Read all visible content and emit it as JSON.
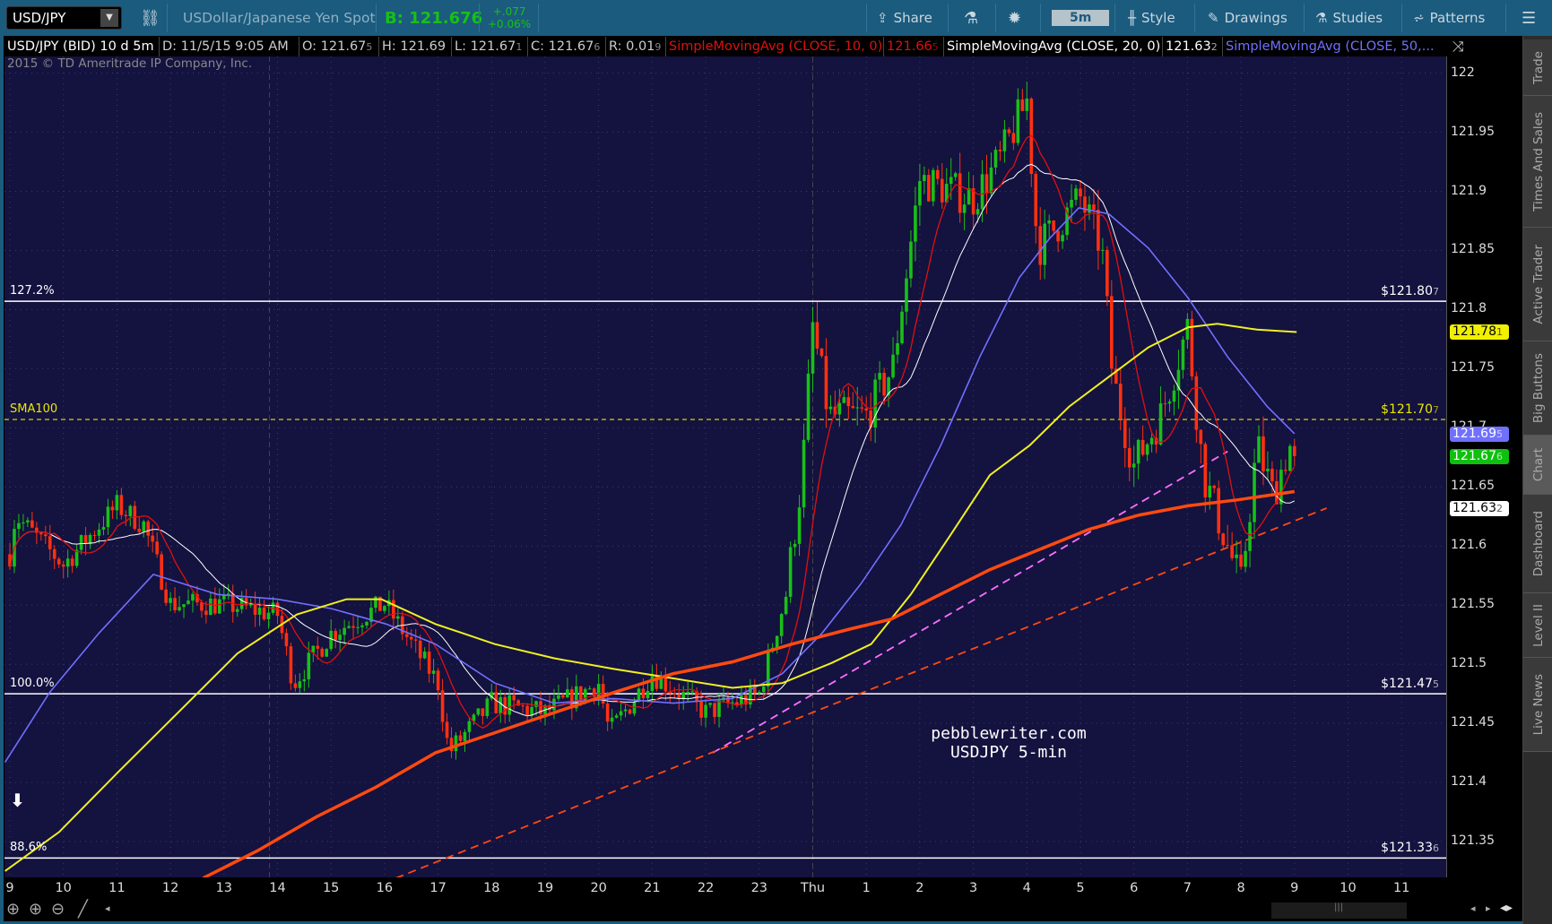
{
  "toolbar": {
    "symbol": "USD/JPY",
    "description": "USDollar/Japanese Yen Spot",
    "bid": "B: 121.676",
    "change_abs": "+.077",
    "change_pct": "+0.06%",
    "share": "Share",
    "timeframe": "5m",
    "style": "Style",
    "drawings": "Drawings",
    "studies": "Studies",
    "patterns": "Patterns"
  },
  "infobar": {
    "title": "USD/JPY (BID) 10 d 5m",
    "date": "D: 11/5/15 9:05 AM",
    "open": [
      "O: 121.67",
      "5"
    ],
    "high": [
      "H: 121.69",
      ""
    ],
    "low": [
      "L: 121.67",
      "1"
    ],
    "close": [
      "C: 121.67",
      "6"
    ],
    "range": [
      "R: 0.01",
      "9"
    ],
    "sma10": "SimpleMovingAvg (CLOSE, 10, 0)",
    "sma10_val": [
      "121.66",
      "5"
    ],
    "sma20": "SimpleMovingAvg (CLOSE, 20, 0)",
    "sma20_val": [
      "121.63",
      "2"
    ],
    "sma50": "SimpleMovingAvg (CLOSE, 50,..."
  },
  "copyright": "2015 © TD Ameritrade IP Company, Inc.",
  "levels": [
    {
      "label": "127.2%",
      "price": 121.807,
      "text": [
        "$121.80",
        "7"
      ],
      "color": "#ffffff",
      "dashed": false
    },
    {
      "label": "SMA100",
      "price": 121.707,
      "text": [
        "$121.70",
        "7"
      ],
      "color": "#e8e800",
      "dashed": true
    },
    {
      "label": "100.0%",
      "price": 121.475,
      "text": [
        "$121.47",
        "5"
      ],
      "color": "#ffffff",
      "dashed": false
    },
    {
      "label": "88.6%",
      "price": 121.336,
      "text": [
        "$121.33",
        "6"
      ],
      "color": "#ffffff",
      "dashed": false
    }
  ],
  "watermark": {
    "line1": "pebblewriter.com",
    "line2": "USDJPY 5-min"
  },
  "sidebar": [
    "Trade",
    "Times And Sales",
    "Active Trader",
    "Big Buttons",
    "Chart",
    "Dashboard",
    "Level II",
    "Live News"
  ],
  "chart_data": {
    "type": "candlestick",
    "ylim": [
      121.32,
      122.01
    ],
    "yticks": [
      "122",
      "121.95",
      "121.9",
      "121.85",
      "121.8",
      "121.75",
      "121.7",
      "121.65",
      "121.6",
      "121.55",
      "121.5",
      "121.45",
      "121.4",
      "121.35"
    ],
    "xticks": [
      "9",
      "10",
      "11",
      "12",
      "13",
      "14",
      "15",
      "16",
      "17",
      "18",
      "19",
      "20",
      "21",
      "22",
      "23",
      "Thu",
      "1",
      "2",
      "3",
      "4",
      "5",
      "6",
      "7",
      "8",
      "9",
      "10",
      "11"
    ],
    "price_path": [
      [
        0,
        121.593
      ],
      [
        0.1,
        121.626
      ],
      [
        1,
        121.584
      ],
      [
        2,
        121.634
      ],
      [
        2.5,
        121.618
      ],
      [
        3,
        121.551
      ],
      [
        4,
        121.551
      ],
      [
        5,
        121.542
      ],
      [
        5.3,
        121.484
      ],
      [
        6,
        121.526
      ],
      [
        7,
        121.551
      ],
      [
        8,
        121.484
      ],
      [
        8.2,
        121.425
      ],
      [
        9,
        121.467
      ],
      [
        10,
        121.459
      ],
      [
        11,
        121.484
      ],
      [
        11.2,
        121.442
      ],
      [
        12,
        121.492
      ],
      [
        13,
        121.459
      ],
      [
        14,
        121.475
      ],
      [
        14.5,
        121.559
      ],
      [
        14.8,
        121.66
      ],
      [
        15,
        121.785
      ],
      [
        15.3,
        121.71
      ],
      [
        16,
        121.71
      ],
      [
        16.5,
        121.752
      ],
      [
        17,
        121.91
      ],
      [
        18,
        121.894
      ],
      [
        18.5,
        121.927
      ],
      [
        19,
        121.977
      ],
      [
        19.2,
        121.852
      ],
      [
        20,
        121.894
      ],
      [
        20.4,
        121.852
      ],
      [
        20.6,
        121.743
      ],
      [
        21,
        121.668
      ],
      [
        21.5,
        121.71
      ],
      [
        22,
        121.785
      ],
      [
        22.3,
        121.66
      ],
      [
        23,
        121.567
      ],
      [
        23.3,
        121.685
      ],
      [
        23.6,
        121.643
      ],
      [
        23.9,
        121.685
      ],
      [
        24,
        121.676
      ]
    ],
    "series": [
      {
        "name": "SMA50",
        "color": "#7070ff",
        "points": [
          [
            -0.09,
            121.417
          ],
          [
            0.74,
            121.476
          ],
          [
            1.66,
            121.526
          ],
          [
            2.68,
            121.576
          ],
          [
            3.88,
            121.559
          ],
          [
            5,
            121.555
          ],
          [
            6.01,
            121.547
          ],
          [
            7.03,
            121.534
          ],
          [
            7.95,
            121.517
          ],
          [
            9.06,
            121.484
          ],
          [
            10.17,
            121.467
          ],
          [
            11.28,
            121.471
          ],
          [
            12.39,
            121.467
          ],
          [
            13.5,
            121.471
          ],
          [
            14.43,
            121.492
          ],
          [
            15.17,
            121.526
          ],
          [
            15.9,
            121.568
          ],
          [
            16.65,
            121.618
          ],
          [
            17.39,
            121.685
          ],
          [
            18.12,
            121.76
          ],
          [
            18.86,
            121.827
          ],
          [
            19.42,
            121.86
          ],
          [
            19.97,
            121.886
          ],
          [
            20.53,
            121.881
          ],
          [
            21.27,
            121.852
          ],
          [
            22.01,
            121.81
          ],
          [
            22.75,
            121.76
          ],
          [
            23.49,
            121.718
          ],
          [
            24,
            121.695
          ]
        ]
      },
      {
        "name": "SMA100",
        "color": "#f0f020",
        "points": [
          [
            -0.09,
            121.325
          ],
          [
            0.92,
            121.358
          ],
          [
            2.03,
            121.409
          ],
          [
            3.14,
            121.459
          ],
          [
            4.25,
            121.509
          ],
          [
            5.36,
            121.542
          ],
          [
            6.29,
            121.555
          ],
          [
            6.94,
            121.555
          ],
          [
            7.95,
            121.534
          ],
          [
            9.06,
            121.517
          ],
          [
            10.17,
            121.505
          ],
          [
            11.28,
            121.496
          ],
          [
            12.39,
            121.488
          ],
          [
            13.5,
            121.48
          ],
          [
            14.43,
            121.484
          ],
          [
            15.35,
            121.501
          ],
          [
            16.09,
            121.517
          ],
          [
            16.83,
            121.559
          ],
          [
            17.57,
            121.609
          ],
          [
            18.31,
            121.66
          ],
          [
            19.05,
            121.685
          ],
          [
            19.79,
            121.718
          ],
          [
            20.53,
            121.743
          ],
          [
            21.27,
            121.768
          ],
          [
            22.01,
            121.785
          ],
          [
            22.56,
            121.788
          ],
          [
            23.3,
            121.783
          ],
          [
            24.04,
            121.781
          ]
        ]
      },
      {
        "name": "SMA200",
        "color": "#ff4a10",
        "points": [
          [
            3.61,
            121.319
          ],
          [
            4.62,
            121.342
          ],
          [
            5.73,
            121.371
          ],
          [
            6.84,
            121.396
          ],
          [
            7.95,
            121.425
          ],
          [
            9.06,
            121.442
          ],
          [
            10.17,
            121.459
          ],
          [
            11.28,
            121.476
          ],
          [
            12.39,
            121.492
          ],
          [
            13.5,
            121.502
          ],
          [
            14.61,
            121.517
          ],
          [
            15.72,
            121.53
          ],
          [
            16.46,
            121.538
          ],
          [
            17.38,
            121.559
          ],
          [
            18.31,
            121.58
          ],
          [
            19.23,
            121.597
          ],
          [
            20.16,
            121.614
          ],
          [
            21.08,
            121.626
          ],
          [
            22.01,
            121.634
          ],
          [
            22.93,
            121.639
          ],
          [
            24,
            121.646
          ]
        ]
      }
    ],
    "trendlines": [
      {
        "color": "#ff70ff",
        "from": [
          13.13,
          121.425
        ],
        "to": [
          22.75,
          121.68
        ]
      },
      {
        "color": "#ff4a10",
        "from": [
          7.21,
          121.319
        ],
        "to": [
          24.6,
          121.632
        ]
      }
    ],
    "badges": [
      {
        "text": [
          "121.78",
          "1"
        ],
        "price": 121.781,
        "bg": "#f0f000",
        "fg": "#000"
      },
      {
        "text": [
          "121.69",
          "5"
        ],
        "price": 121.695,
        "bg": "#7070ff",
        "fg": "#fff"
      },
      {
        "text": [
          "121.67",
          "6"
        ],
        "price": 121.676,
        "bg": "#10c010",
        "fg": "#fff"
      },
      {
        "text": [
          "121.63",
          "2"
        ],
        "price": 121.632,
        "bg": "#ffffff",
        "fg": "#000"
      }
    ]
  }
}
